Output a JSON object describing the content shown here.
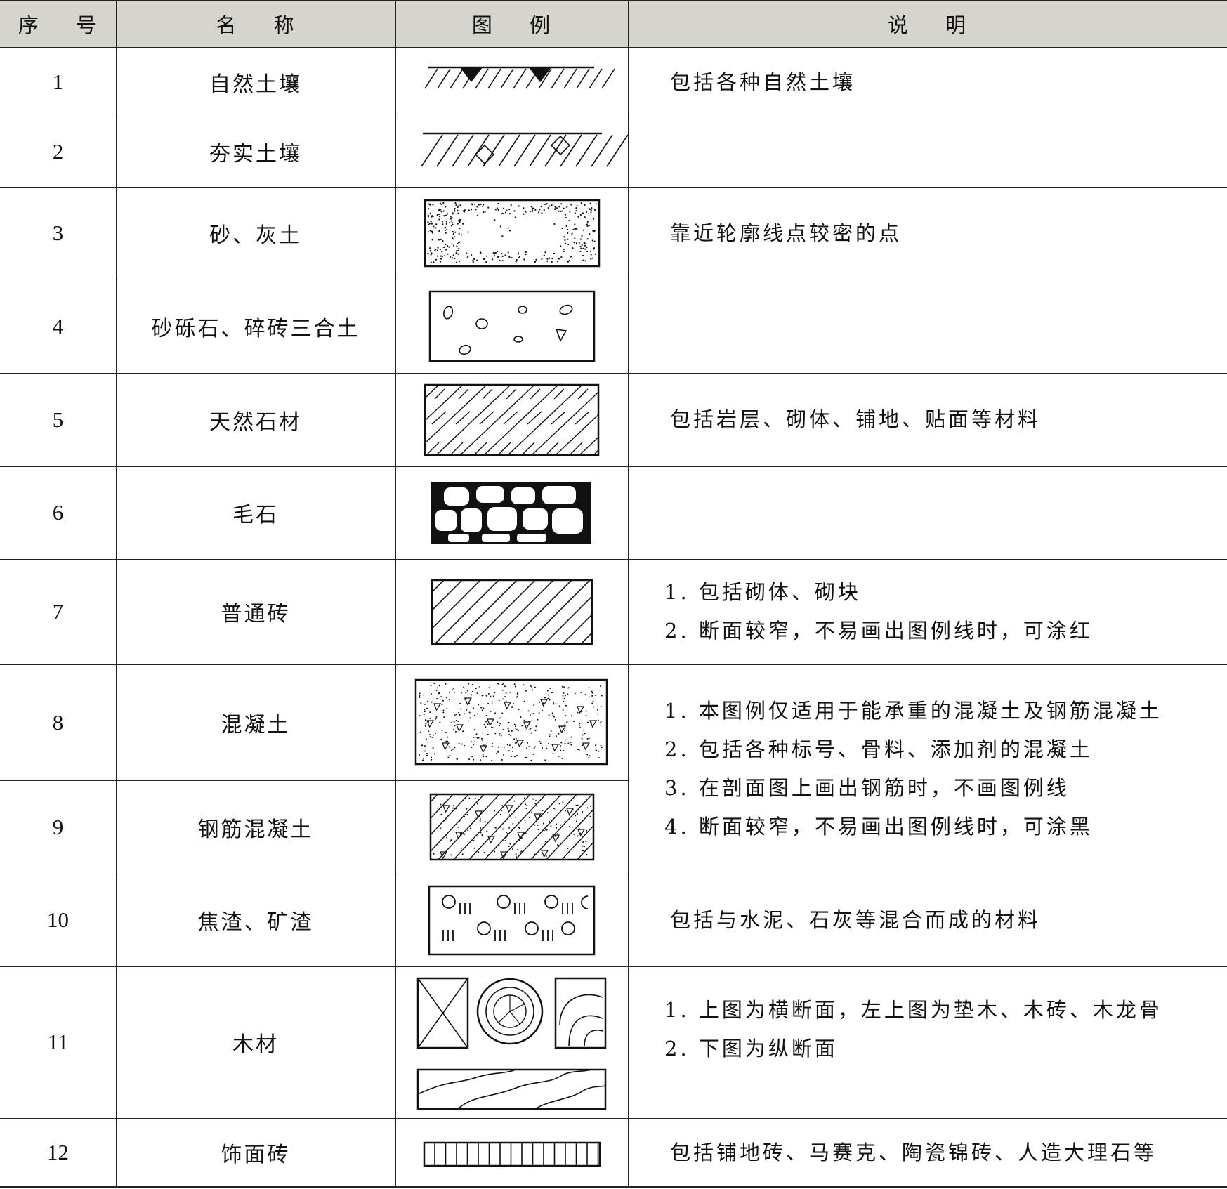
{
  "header": {
    "col_no": "序 号",
    "col_name": "名 称",
    "col_legend": "图 例",
    "col_desc": "说 明"
  },
  "rows": [
    {
      "no": "1",
      "name": "自然土壤",
      "legend_icon": "natural-soil-hatch",
      "desc": [
        "包括各种自然土壤"
      ]
    },
    {
      "no": "2",
      "name": "夯实土壤",
      "legend_icon": "compacted-soil-hatch",
      "desc": []
    },
    {
      "no": "3",
      "name": "砂、灰土",
      "legend_icon": "sand-dots-pattern",
      "desc": [
        "靠近轮廓线点较密的点"
      ]
    },
    {
      "no": "4",
      "name": "砂砾石、碎砖三合土",
      "legend_icon": "gravel-pattern",
      "desc": []
    },
    {
      "no": "5",
      "name": "天然石材",
      "legend_icon": "natural-stone-hatch",
      "desc": [
        "包括岩层、砌体、铺地、贴面等材料"
      ]
    },
    {
      "no": "6",
      "name": "毛石",
      "legend_icon": "rubble-stone-pattern",
      "desc": []
    },
    {
      "no": "7",
      "name": "普通砖",
      "legend_icon": "brick-hatch",
      "desc": [
        "1. 包括砌体、砌块",
        "2. 断面较窄，不易画出图例线时，可涂红"
      ]
    },
    {
      "no": "8",
      "name": "混凝土",
      "legend_icon": "concrete-pattern",
      "desc": []
    },
    {
      "no": "9",
      "name": "钢筋混凝土",
      "legend_icon": "reinforced-concrete-pattern",
      "desc": []
    },
    {
      "no": "10",
      "name": "焦渣、矿渣",
      "legend_icon": "slag-pattern",
      "desc": [
        "包括与水泥、石灰等混合而成的材料"
      ]
    },
    {
      "no": "11",
      "name": "木材",
      "legend_icon": "timber-sections",
      "desc": [
        "1. 上图为横断面，左上图为垫木、木砖、木龙骨",
        "2. 下图为纵断面"
      ]
    },
    {
      "no": "12",
      "name": "饰面砖",
      "legend_icon": "facing-tile-pattern",
      "desc": [
        "包括铺地砖、马赛克、陶瓷锦砖、人造大理石等"
      ]
    }
  ],
  "concrete_desc": [
    "1. 本图例仅适用于能承重的混凝土及钢筋混凝土",
    "2. 包括各种标号、骨料、添加剂的混凝土",
    "3. 在剖面图上画出钢筋时，不画图例线",
    "4. 断面较窄，不易画出图例线时，可涂黑"
  ]
}
